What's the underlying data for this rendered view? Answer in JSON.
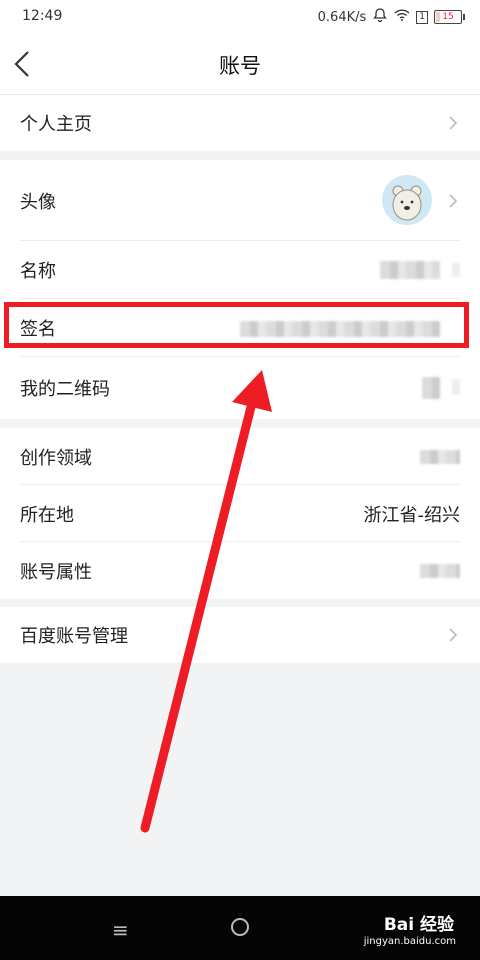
{
  "status_bar": {
    "time": "12:49",
    "speed": "0.64K/s",
    "sim": "1",
    "battery": "15"
  },
  "header": {
    "title": "账号"
  },
  "rows": {
    "homepage": "个人主页",
    "avatar": "头像",
    "name": "名称",
    "signature": "签名",
    "qrcode": "我的二维码",
    "domain": "创作领域",
    "location": "所在地",
    "location_value": "浙江省-绍兴",
    "attribute": "账号属性",
    "baidu_manage": "百度账号管理"
  },
  "watermark": {
    "main": "Bai 经验",
    "sub": "jingyan.baidu.com"
  },
  "colors": {
    "highlight": "#ee1c24",
    "background": "#f2f3f5"
  }
}
